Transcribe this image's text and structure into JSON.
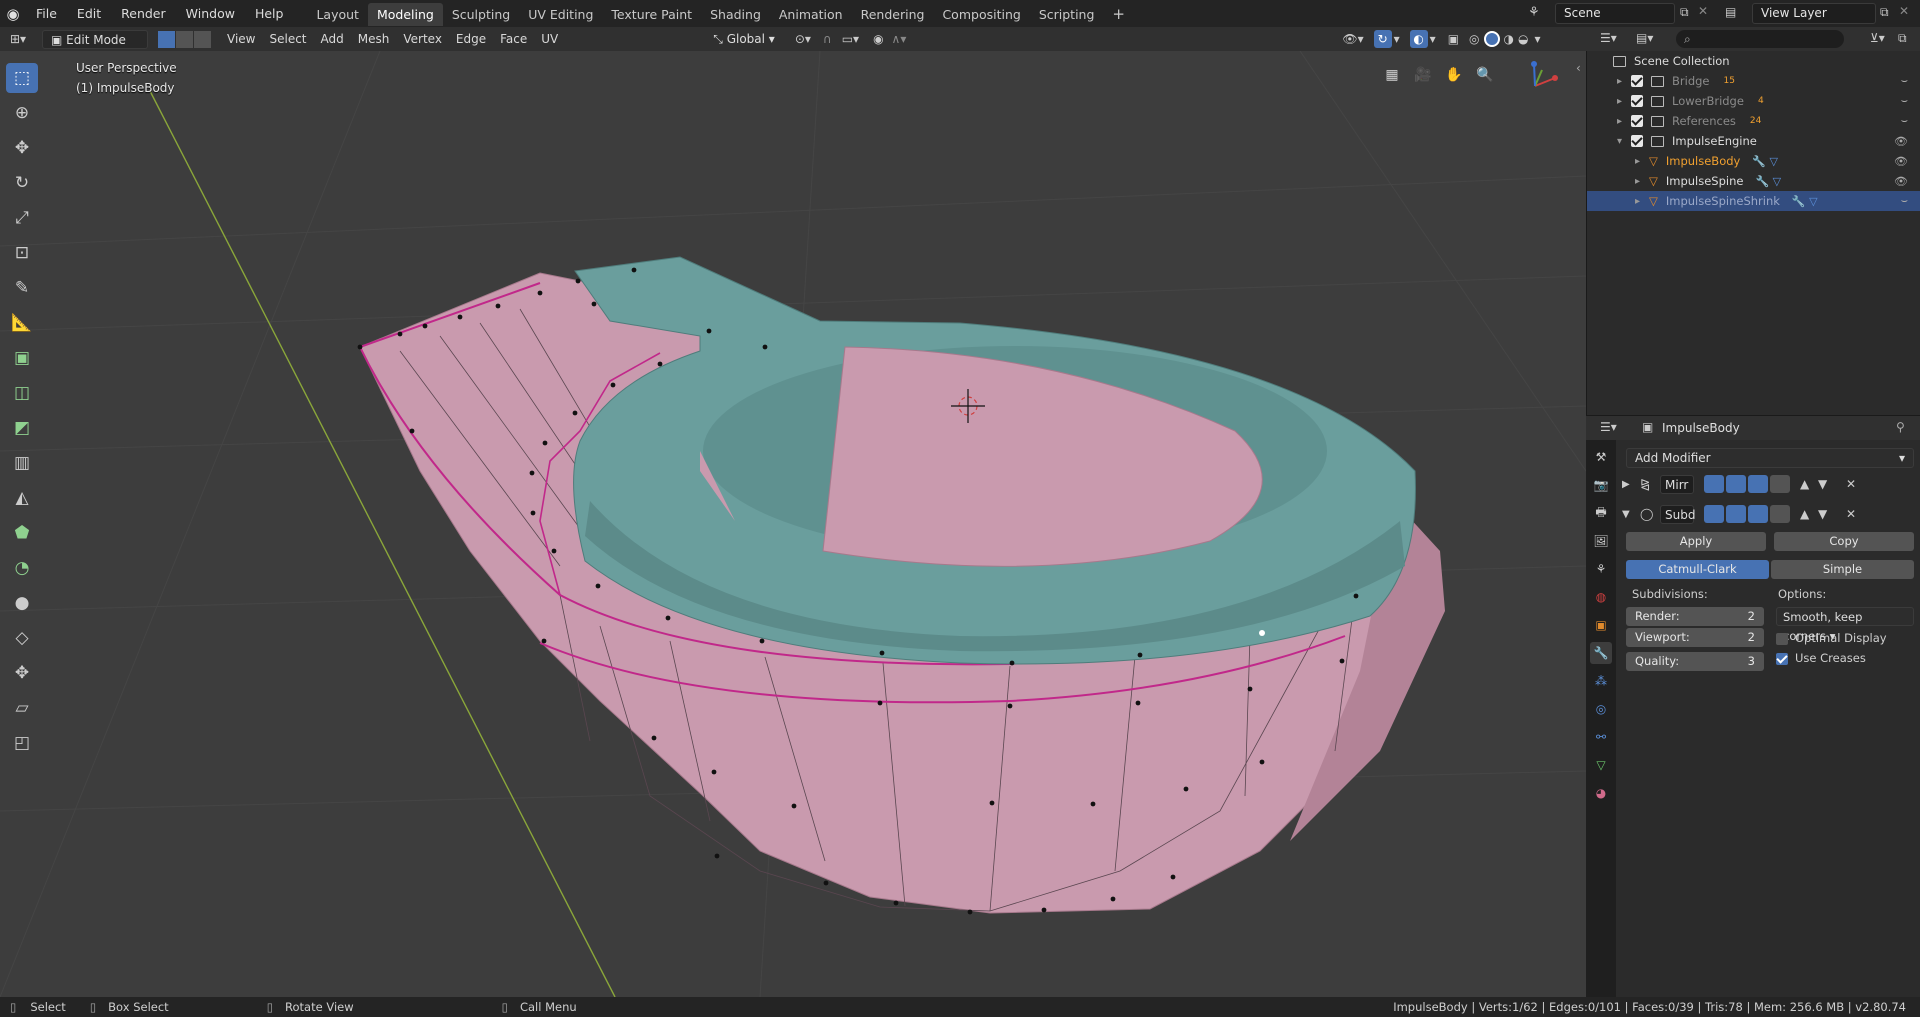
{
  "app": {
    "logo_icon": "blender-logo-icon"
  },
  "topbar": {
    "menus": [
      "File",
      "Edit",
      "Render",
      "Window",
      "Help"
    ],
    "workspaces": [
      "Layout",
      "Modeling",
      "Sculpting",
      "UV Editing",
      "Texture Paint",
      "Shading",
      "Animation",
      "Rendering",
      "Compositing",
      "Scripting"
    ],
    "active_workspace": "Modeling",
    "add_tab": "+",
    "scene": "Scene",
    "view_layer": "View Layer"
  },
  "header": {
    "mode": "Edit Mode",
    "menus": [
      "View",
      "Select",
      "Add",
      "Mesh",
      "Vertex",
      "Edge",
      "Face",
      "UV"
    ],
    "orientation": "Global"
  },
  "viewport": {
    "view_name": "User Perspective",
    "object_label": "(1) ImpulseBody",
    "colors": {
      "background": "#3d3d3d",
      "teal": "#6a9e9d",
      "pink": "#c99aae",
      "selected_edge": "#c1288a",
      "y_axis": "#8aa63a"
    }
  },
  "outliner": {
    "root": "Scene Collection",
    "rows": [
      {
        "name": "Bridge",
        "badge": "15",
        "visible": false
      },
      {
        "name": "LowerBridge",
        "badge": "4",
        "visible": false
      },
      {
        "name": "References",
        "badge": "24",
        "visible": false
      },
      {
        "name": "ImpulseEngine",
        "badge": "",
        "visible": true
      },
      {
        "name": "ImpulseBody",
        "badge": "",
        "visible": true
      },
      {
        "name": "ImpulseSpine",
        "badge": "",
        "visible": true
      },
      {
        "name": "ImpulseSpineShrink",
        "badge": "",
        "visible": false
      }
    ]
  },
  "properties": {
    "object_name": "ImpulseBody",
    "add_modifier": "Add Modifier",
    "modifiers": [
      {
        "name": "Mirr",
        "expanded": false
      },
      {
        "name": "Subd",
        "expanded": true
      }
    ],
    "apply": "Apply",
    "copy": "Copy",
    "catmull": "Catmull-Clark",
    "simple": "Simple",
    "subdivisions_label": "Subdivisions:",
    "options_label": "Options:",
    "render_label": "Render:",
    "render_value": "2",
    "viewport_label": "Viewport:",
    "viewport_value": "2",
    "quality_label": "Quality:",
    "quality_value": "3",
    "uv_smooth": "Smooth, keep corners",
    "optimal_display": "Optimal Display",
    "optimal_checked": false,
    "use_creases": "Use Creases",
    "creases_checked": true
  },
  "statusbar": {
    "select": "Select",
    "box_select": "Box Select",
    "rotate": "Rotate View",
    "call_menu": "Call Menu",
    "stats": "ImpulseBody | Verts:1/62 | Edges:0/101 | Faces:0/39 | Tris:78 | Mem: 256.6 MB | v2.80.74"
  }
}
